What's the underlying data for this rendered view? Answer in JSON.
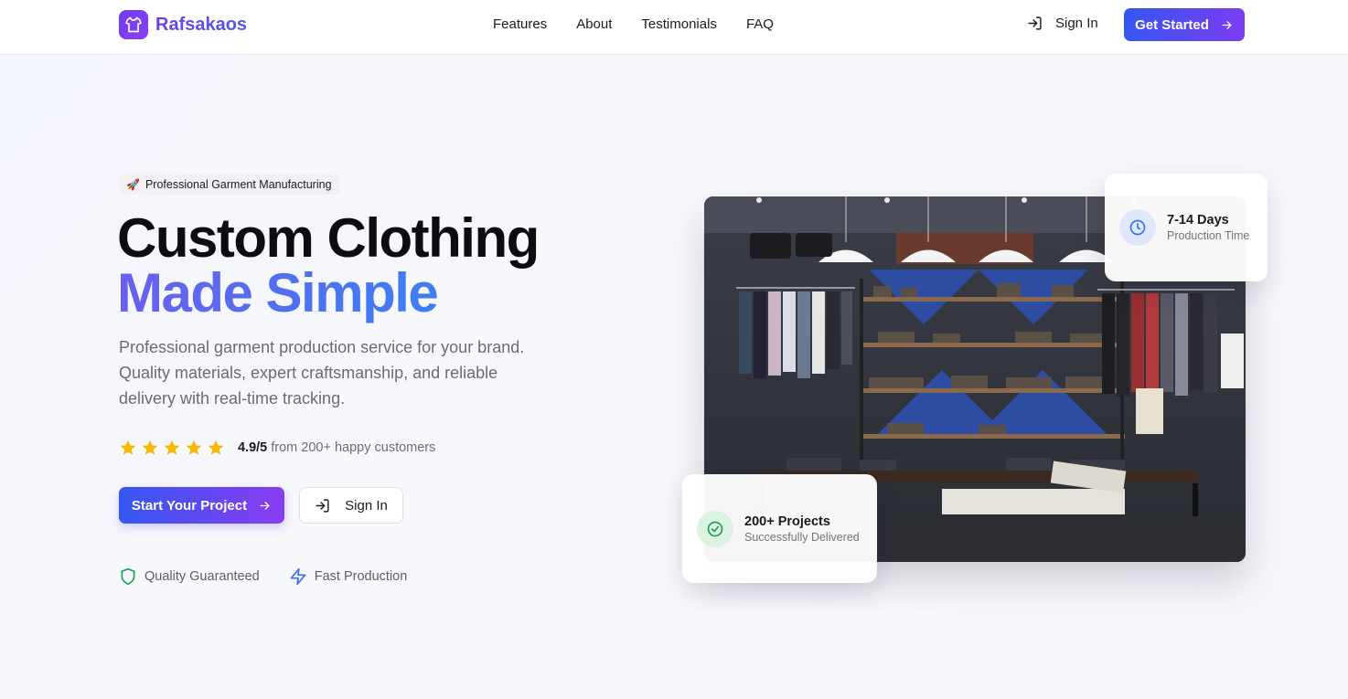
{
  "brand": {
    "name": "Rafsakaos",
    "logo_icon": "shirt-icon"
  },
  "nav": {
    "items": [
      "Features",
      "About",
      "Testimonials",
      "FAQ"
    ]
  },
  "header": {
    "signin_label": "Sign In",
    "cta_label": "Get Started"
  },
  "hero": {
    "badge": "Professional Garment Manufacturing",
    "title_line1": "Custom Clothing",
    "title_line2": "Made Simple",
    "description": "Professional garment production service for your brand. Quality materials, expert craftsmanship, and reliable delivery with real-time tracking.",
    "rating": {
      "stars": 5,
      "score": "4.9/5",
      "text": "from 200+ happy customers"
    },
    "primary_button": "Start Your Project",
    "secondary_button": "Sign In",
    "features": [
      "Quality Guaranteed",
      "Fast Production"
    ]
  },
  "stats": {
    "production": {
      "title": "7-14 Days",
      "subtitle": "Production Time"
    },
    "projects": {
      "title": "200+ Projects",
      "subtitle": "Successfully Delivered"
    }
  },
  "colors": {
    "brand_gradient_start": "#3457f0",
    "brand_gradient_end": "#8a3cf0",
    "star": "#f5b800",
    "green": "#1f9d55",
    "blue": "#3b6ef0"
  }
}
